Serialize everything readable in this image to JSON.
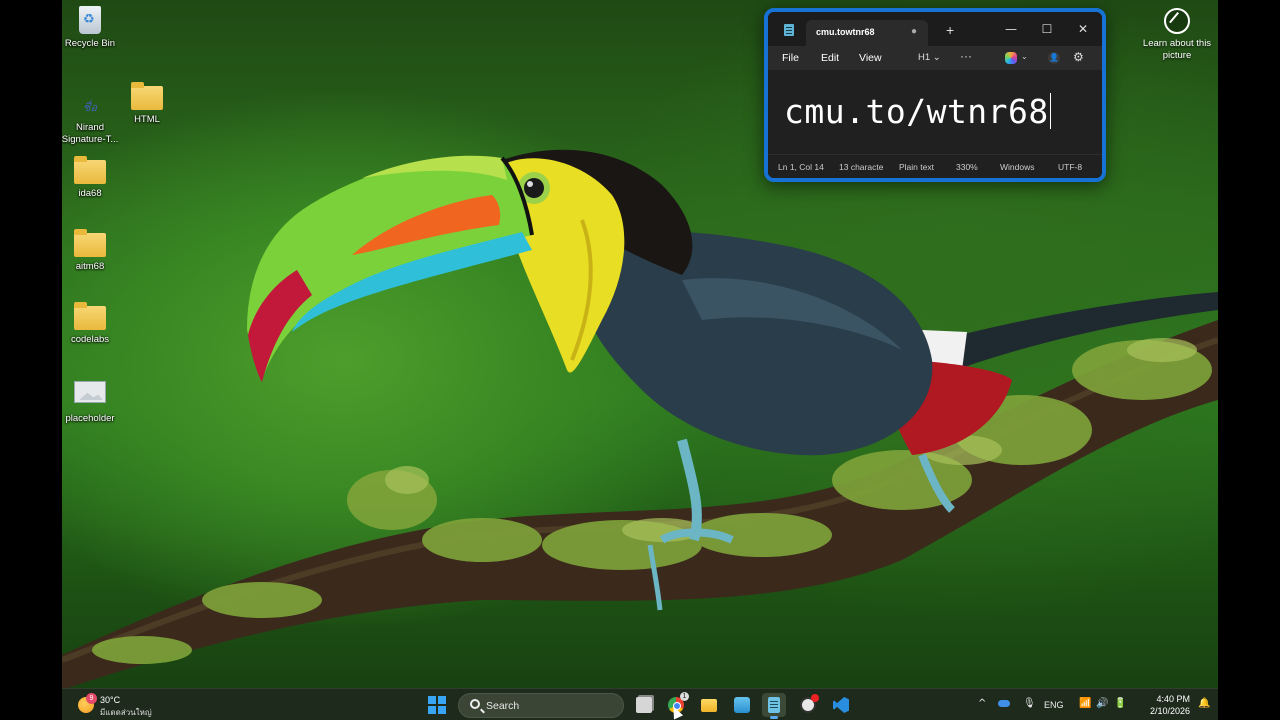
{
  "desktop": {
    "icons": [
      {
        "label": "Recycle Bin",
        "icon": "recycle-bin-icon"
      },
      {
        "label": "Nirand Signature-T...",
        "icon": "signature-file-icon"
      },
      {
        "label": "HTML",
        "icon": "folder-icon"
      },
      {
        "label": "ida68",
        "icon": "folder-icon"
      },
      {
        "label": "aitm68",
        "icon": "folder-icon"
      },
      {
        "label": "codelabs",
        "icon": "folder-icon"
      },
      {
        "label": "placeholder",
        "icon": "image-file-icon"
      }
    ],
    "learn_about": "Learn about this picture",
    "signature_glyph": "ชื่อ"
  },
  "notepad": {
    "tab_title": "cmu.towtnr68",
    "tab_unsaved": "●",
    "new_tab": "+",
    "window_controls": {
      "minimize": "—",
      "maximize": "☐",
      "close": "✕"
    },
    "menu": {
      "file": "File",
      "edit": "Edit",
      "view": "View"
    },
    "heading": "H1",
    "heading_chevron": "⌄",
    "more": "···",
    "chevron": "⌄",
    "account": "👤",
    "settings": "⚙",
    "content": "cmu.to/wtnr68",
    "status": {
      "position": "Ln 1, Col 14",
      "chars": "13 characte",
      "type": "Plain text",
      "zoom": "330%",
      "eol": "Windows",
      "encoding": "UTF-8"
    }
  },
  "taskbar": {
    "weather": {
      "temp": "30°C",
      "desc": "มีแดดส่วนใหญ่",
      "badge": "9"
    },
    "search": "Search",
    "apps": [
      {
        "name": "task-view",
        "icon": "task-view-icon"
      },
      {
        "name": "chrome",
        "icon": "chrome-icon",
        "badge": "1"
      },
      {
        "name": "file-explorer",
        "icon": "folder-icon"
      },
      {
        "name": "photos",
        "icon": "photos-icon"
      },
      {
        "name": "notepad",
        "icon": "notepad-icon",
        "active": true
      },
      {
        "name": "obs",
        "icon": "obs-icon"
      },
      {
        "name": "vscode",
        "icon": "vscode-icon"
      }
    ],
    "tray": {
      "chevron": "^",
      "language": "ENG",
      "mic": "🎙",
      "wifi": "📶",
      "volume": "🔊",
      "battery": "🔋",
      "bell": "🔔",
      "time": "4:40 PM",
      "date": "2/10/2026"
    }
  },
  "colors": {
    "accent": "#1672d4",
    "window_bg": "#202020",
    "taskbar_bg": "#1e2b1c"
  }
}
